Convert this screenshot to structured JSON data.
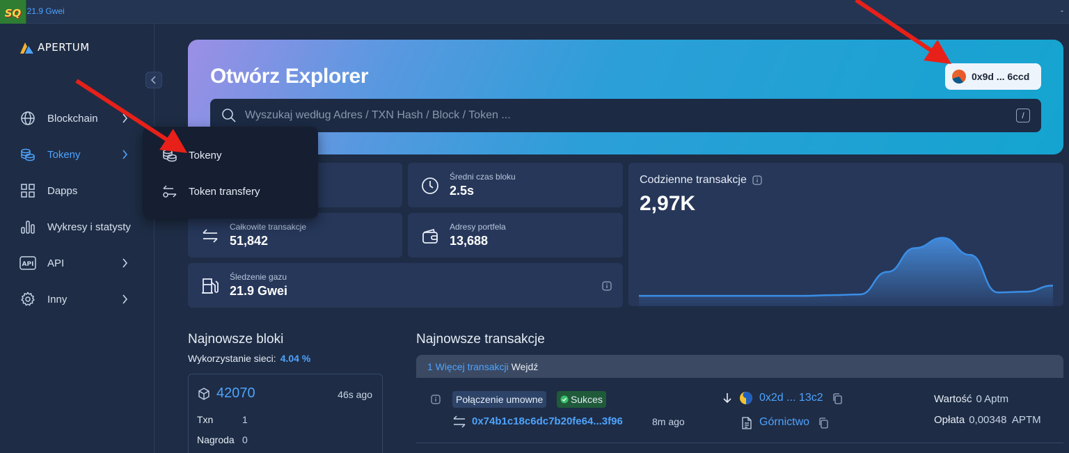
{
  "topbar": {
    "gas_text": ": 21.9 Gwei",
    "logo_text": "SQ",
    "right_mark": "-"
  },
  "brand": {
    "name": "APERTUM"
  },
  "nav": [
    {
      "label": "Blockchain",
      "icon": "globe-icon"
    },
    {
      "label": "Tokeny",
      "icon": "coins-icon"
    },
    {
      "label": "Dapps",
      "icon": "grid-icon"
    },
    {
      "label": "Wykresy i statysty",
      "icon": "bar-chart-icon"
    },
    {
      "label": "API",
      "icon": "api-icon"
    },
    {
      "label": "Inny",
      "icon": "gear-icon"
    }
  ],
  "dropdown": [
    {
      "label": "Tokeny",
      "icon": "coins-icon"
    },
    {
      "label": "Token transfery",
      "icon": "token-transfer-icon"
    }
  ],
  "hero": {
    "title": "Otwórz Explorer",
    "wallet": "0x9d ... 6ccd",
    "search_placeholder": "Wyszukaj według Adres / TXN Hash / Block / Token ...",
    "search_shortcut": "/"
  },
  "stats": {
    "block_time": {
      "label": "Średni czas bloku",
      "value": "2.5s"
    },
    "total_tx": {
      "label": "Całkowite transakcje",
      "value": "51,842"
    },
    "wallets": {
      "label": "Adresy portfela",
      "value": "13,688"
    },
    "gas": {
      "label": "Śledzenie gazu",
      "value": "21.9 Gwei"
    }
  },
  "daily": {
    "title": "Codzienne transakcje",
    "value": "2,97K",
    "series": [
      0.05,
      0.05,
      0.05,
      0.05,
      0.05,
      0.05,
      0.05,
      0.06,
      0.07,
      0.4,
      0.75,
      0.9,
      0.65,
      0.1,
      0.11,
      0.2
    ]
  },
  "blocks": {
    "title": "Najnowsze bloki",
    "util_label": "Wykorzystanie sieci:",
    "util_value": "4.04 %",
    "latest": {
      "number": "42070",
      "ago": "46s ago",
      "txn_label": "Txn",
      "txn_value": "1",
      "reward_label": "Nagroda",
      "reward_value": "0"
    }
  },
  "transactions": {
    "title": "Najnowsze transakcje",
    "more_link": "1 Więcej transakcji",
    "more_action": "Wejdź",
    "row": {
      "type": "Połączenie umowne",
      "status": "Sukces",
      "hash": "0x74b1c18c6dc7b20fe64...3f96",
      "ago": "8m ago",
      "from": "0x2d ... 13c2",
      "method": "Górnictwo",
      "value_label": "Wartość",
      "value": "0 Aptm",
      "fee_label": "Opłata",
      "fee": "0,00348  APTM"
    }
  },
  "colors": {
    "accent": "#4ea3ff",
    "annotation_arrow": "#e8201a"
  }
}
